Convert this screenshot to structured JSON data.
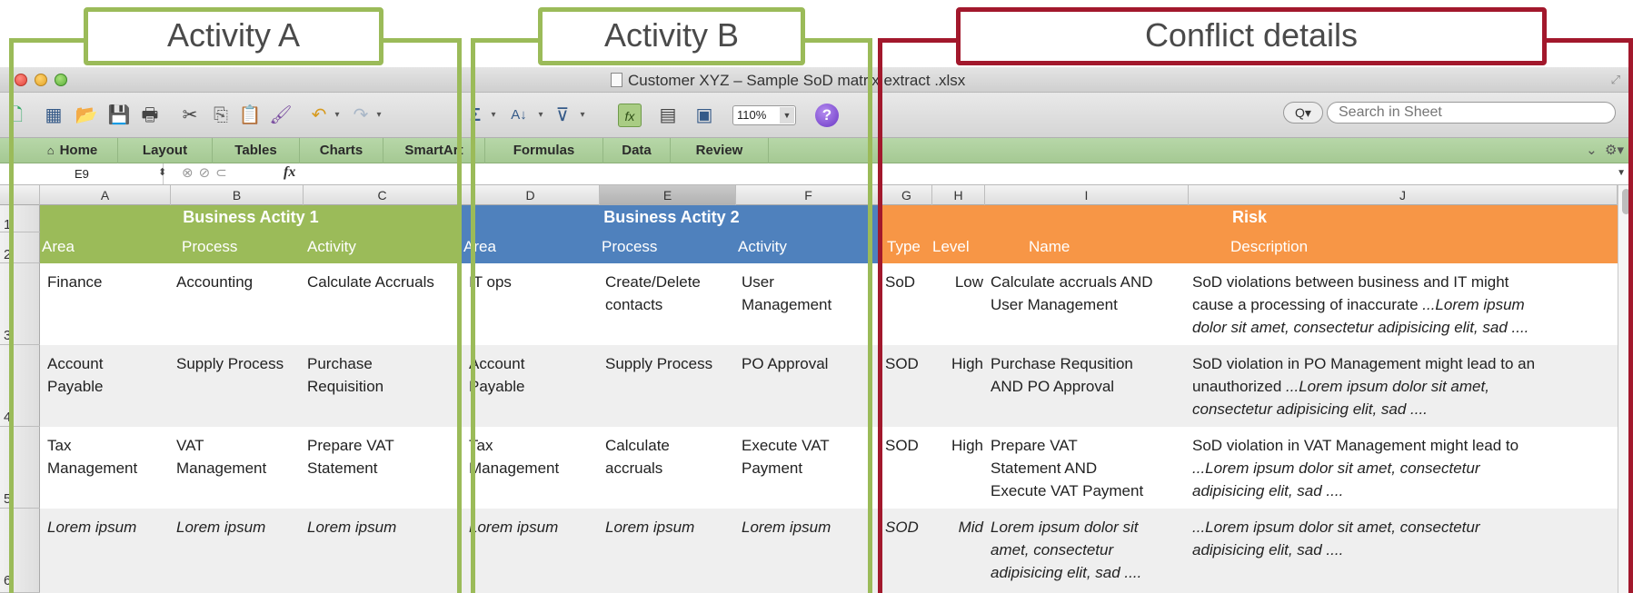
{
  "callouts": {
    "activity_a": "Activity A",
    "activity_b": "Activity B",
    "conflict": "Conflict details"
  },
  "window": {
    "title": "Customer XYZ – Sample SoD matrix extract .xlsx"
  },
  "toolbar": {
    "zoom": "110%",
    "search_placeholder": "Search in Sheet",
    "search_mag": "Q▾"
  },
  "ribbon": {
    "tabs": [
      "Home",
      "Layout",
      "Tables",
      "Charts",
      "SmartArt",
      "Formulas",
      "Data",
      "Review"
    ]
  },
  "formula_bar": {
    "cell_ref": "E9",
    "fx": "fx"
  },
  "columns": [
    "A",
    "B",
    "C",
    "D",
    "E",
    "F",
    "G",
    "H",
    "I",
    "J"
  ],
  "rows": [
    "1",
    "2",
    "3",
    "4",
    "5",
    "6"
  ],
  "headers": {
    "group1": "Business Actity 1",
    "group2": "Business Actity 2",
    "group3": "Risk",
    "area": "Area",
    "process": "Process",
    "activity": "Activity",
    "area2": "Area",
    "process2": "Process",
    "activity2": "Activity",
    "type": "Type",
    "level": "Level",
    "name": "Name",
    "description": "Description"
  },
  "data_rows": [
    {
      "a_area": "Finance",
      "a_process": "Accounting",
      "a_activity": "Calculate Accruals",
      "b_area": "IT ops",
      "b_process": "Create/Delete\ncontacts",
      "b_activity": "User\nManagement",
      "type": "SoD",
      "level": "Low",
      "name": "Calculate accruals AND\nUser Management",
      "desc_plain": "SoD violations between business and IT might\ncause a processing of inaccurate ",
      "desc_italic": "...Lorem ipsum\ndolor sit amet, consectetur adipisicing elit, sad ...."
    },
    {
      "a_area": "Account\nPayable",
      "a_process": "Supply Process",
      "a_activity": "Purchase\nRequisition",
      "b_area": "Account\nPayable",
      "b_process": "Supply Process",
      "b_activity": "PO Approval",
      "type": "SOD",
      "level": "High",
      "name": "Purchase Requsition\nAND PO Approval",
      "desc_plain": "SoD violation in PO Management might lead to an\nunauthorized ",
      "desc_italic": "...Lorem ipsum dolor sit amet,\nconsectetur adipisicing elit, sad ...."
    },
    {
      "a_area": "Tax\nManagement",
      "a_process": "VAT\nManagement",
      "a_activity": "Prepare VAT\nStatement",
      "b_area": "Tax\nManagement",
      "b_process": "Calculate\naccruals",
      "b_activity": "Execute VAT\nPayment",
      "type": "SOD",
      "level": "High",
      "name": "Prepare VAT\nStatement AND\nExecute VAT Payment",
      "desc_plain": "SoD violation in VAT Management might lead to\n",
      "desc_italic": "...Lorem ipsum dolor sit amet, consectetur\nadipisicing elit, sad ...."
    },
    {
      "a_area": "Lorem ipsum",
      "a_process": "Lorem ipsum",
      "a_activity": "Lorem ipsum",
      "b_area": "Lorem ipsum",
      "b_process": "Lorem ipsum",
      "b_activity": "Lorem ipsum",
      "type": "SOD",
      "level": "Mid",
      "name": "Lorem ipsum dolor sit\namet, consectetur\nadipisicing elit, sad ....",
      "desc_plain": "",
      "desc_italic": "...Lorem ipsum dolor sit amet, consectetur\nadipisicing elit, sad ...."
    }
  ],
  "colors": {
    "activity_green": "#9bbb59",
    "activity_blue": "#4f81bd",
    "risk_orange": "#f79646",
    "conflict_red": "#a2182c"
  }
}
